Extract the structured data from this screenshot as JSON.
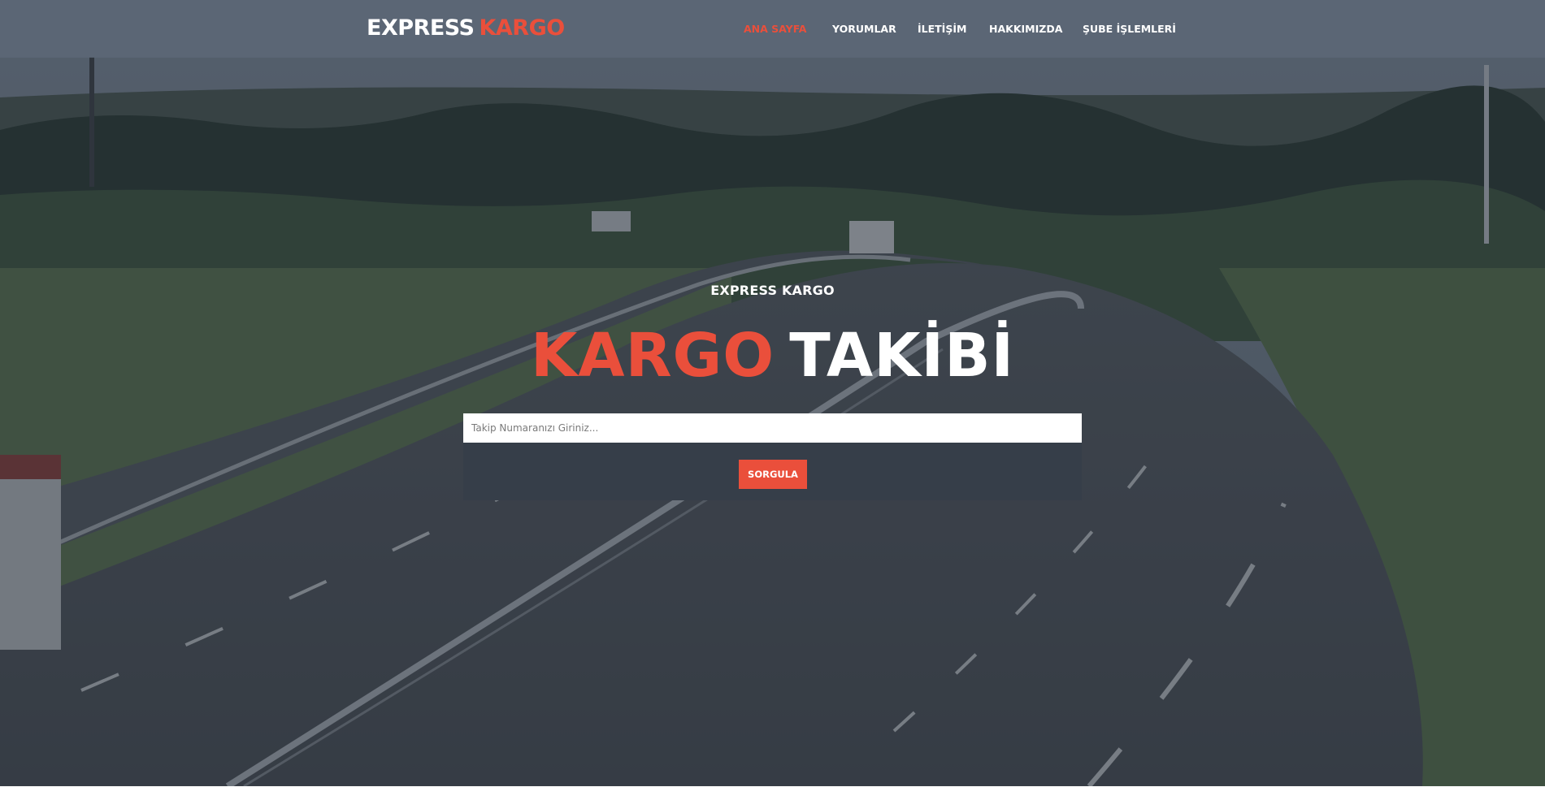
{
  "header": {
    "logo": {
      "part1": "EXPRESS",
      "part2": "KARGO"
    },
    "nav": [
      {
        "label": "ANA SAYFA",
        "active": true
      },
      {
        "label": "YORUMLAR",
        "active": false
      },
      {
        "label": "İLETİŞİM",
        "active": false
      },
      {
        "label": "HAKKIMIZDA",
        "active": false
      },
      {
        "label": "ŞUBE İŞLEMLERİ",
        "active": false
      }
    ]
  },
  "hero": {
    "eyebrow": "EXPRESS KARGO",
    "headline_part1": "KARGO",
    "headline_part2": "TAKİBİ",
    "background": "highway-through-green-fields-photo"
  },
  "search": {
    "placeholder": "Takip Numaranızı Giriniz...",
    "value": "",
    "button_label": "SORGULA"
  },
  "colors": {
    "accent": "#ea4f3b",
    "header_bg": "#5c6876",
    "panel_bg": "#363e49"
  }
}
